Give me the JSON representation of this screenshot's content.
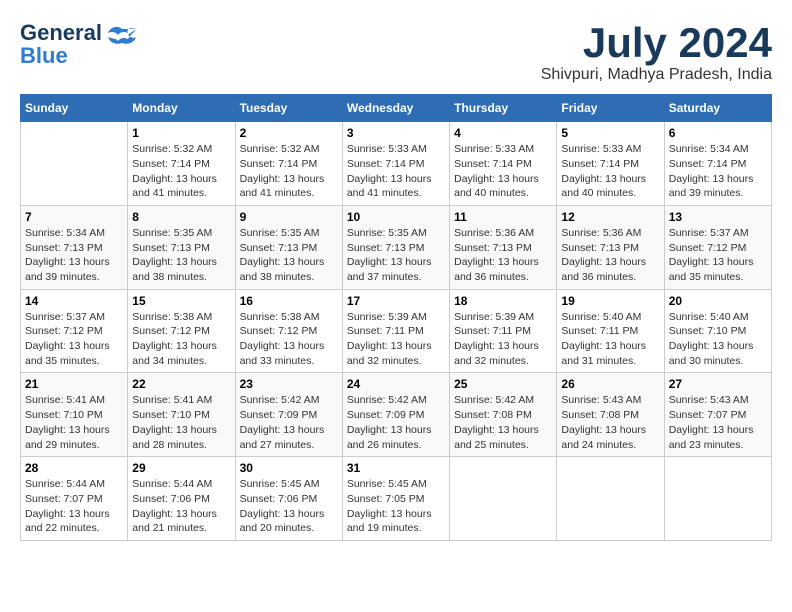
{
  "header": {
    "logo_line1": "General",
    "logo_line2": "Blue",
    "month": "July 2024",
    "location": "Shivpuri, Madhya Pradesh, India"
  },
  "weekdays": [
    "Sunday",
    "Monday",
    "Tuesday",
    "Wednesday",
    "Thursday",
    "Friday",
    "Saturday"
  ],
  "weeks": [
    [
      {
        "day": "",
        "info": ""
      },
      {
        "day": "1",
        "info": "Sunrise: 5:32 AM\nSunset: 7:14 PM\nDaylight: 13 hours\nand 41 minutes."
      },
      {
        "day": "2",
        "info": "Sunrise: 5:32 AM\nSunset: 7:14 PM\nDaylight: 13 hours\nand 41 minutes."
      },
      {
        "day": "3",
        "info": "Sunrise: 5:33 AM\nSunset: 7:14 PM\nDaylight: 13 hours\nand 41 minutes."
      },
      {
        "day": "4",
        "info": "Sunrise: 5:33 AM\nSunset: 7:14 PM\nDaylight: 13 hours\nand 40 minutes."
      },
      {
        "day": "5",
        "info": "Sunrise: 5:33 AM\nSunset: 7:14 PM\nDaylight: 13 hours\nand 40 minutes."
      },
      {
        "day": "6",
        "info": "Sunrise: 5:34 AM\nSunset: 7:14 PM\nDaylight: 13 hours\nand 39 minutes."
      }
    ],
    [
      {
        "day": "7",
        "info": "Sunrise: 5:34 AM\nSunset: 7:13 PM\nDaylight: 13 hours\nand 39 minutes."
      },
      {
        "day": "8",
        "info": "Sunrise: 5:35 AM\nSunset: 7:13 PM\nDaylight: 13 hours\nand 38 minutes."
      },
      {
        "day": "9",
        "info": "Sunrise: 5:35 AM\nSunset: 7:13 PM\nDaylight: 13 hours\nand 38 minutes."
      },
      {
        "day": "10",
        "info": "Sunrise: 5:35 AM\nSunset: 7:13 PM\nDaylight: 13 hours\nand 37 minutes."
      },
      {
        "day": "11",
        "info": "Sunrise: 5:36 AM\nSunset: 7:13 PM\nDaylight: 13 hours\nand 36 minutes."
      },
      {
        "day": "12",
        "info": "Sunrise: 5:36 AM\nSunset: 7:13 PM\nDaylight: 13 hours\nand 36 minutes."
      },
      {
        "day": "13",
        "info": "Sunrise: 5:37 AM\nSunset: 7:12 PM\nDaylight: 13 hours\nand 35 minutes."
      }
    ],
    [
      {
        "day": "14",
        "info": "Sunrise: 5:37 AM\nSunset: 7:12 PM\nDaylight: 13 hours\nand 35 minutes."
      },
      {
        "day": "15",
        "info": "Sunrise: 5:38 AM\nSunset: 7:12 PM\nDaylight: 13 hours\nand 34 minutes."
      },
      {
        "day": "16",
        "info": "Sunrise: 5:38 AM\nSunset: 7:12 PM\nDaylight: 13 hours\nand 33 minutes."
      },
      {
        "day": "17",
        "info": "Sunrise: 5:39 AM\nSunset: 7:11 PM\nDaylight: 13 hours\nand 32 minutes."
      },
      {
        "day": "18",
        "info": "Sunrise: 5:39 AM\nSunset: 7:11 PM\nDaylight: 13 hours\nand 32 minutes."
      },
      {
        "day": "19",
        "info": "Sunrise: 5:40 AM\nSunset: 7:11 PM\nDaylight: 13 hours\nand 31 minutes."
      },
      {
        "day": "20",
        "info": "Sunrise: 5:40 AM\nSunset: 7:10 PM\nDaylight: 13 hours\nand 30 minutes."
      }
    ],
    [
      {
        "day": "21",
        "info": "Sunrise: 5:41 AM\nSunset: 7:10 PM\nDaylight: 13 hours\nand 29 minutes."
      },
      {
        "day": "22",
        "info": "Sunrise: 5:41 AM\nSunset: 7:10 PM\nDaylight: 13 hours\nand 28 minutes."
      },
      {
        "day": "23",
        "info": "Sunrise: 5:42 AM\nSunset: 7:09 PM\nDaylight: 13 hours\nand 27 minutes."
      },
      {
        "day": "24",
        "info": "Sunrise: 5:42 AM\nSunset: 7:09 PM\nDaylight: 13 hours\nand 26 minutes."
      },
      {
        "day": "25",
        "info": "Sunrise: 5:42 AM\nSunset: 7:08 PM\nDaylight: 13 hours\nand 25 minutes."
      },
      {
        "day": "26",
        "info": "Sunrise: 5:43 AM\nSunset: 7:08 PM\nDaylight: 13 hours\nand 24 minutes."
      },
      {
        "day": "27",
        "info": "Sunrise: 5:43 AM\nSunset: 7:07 PM\nDaylight: 13 hours\nand 23 minutes."
      }
    ],
    [
      {
        "day": "28",
        "info": "Sunrise: 5:44 AM\nSunset: 7:07 PM\nDaylight: 13 hours\nand 22 minutes."
      },
      {
        "day": "29",
        "info": "Sunrise: 5:44 AM\nSunset: 7:06 PM\nDaylight: 13 hours\nand 21 minutes."
      },
      {
        "day": "30",
        "info": "Sunrise: 5:45 AM\nSunset: 7:06 PM\nDaylight: 13 hours\nand 20 minutes."
      },
      {
        "day": "31",
        "info": "Sunrise: 5:45 AM\nSunset: 7:05 PM\nDaylight: 13 hours\nand 19 minutes."
      },
      {
        "day": "",
        "info": ""
      },
      {
        "day": "",
        "info": ""
      },
      {
        "day": "",
        "info": ""
      }
    ]
  ]
}
